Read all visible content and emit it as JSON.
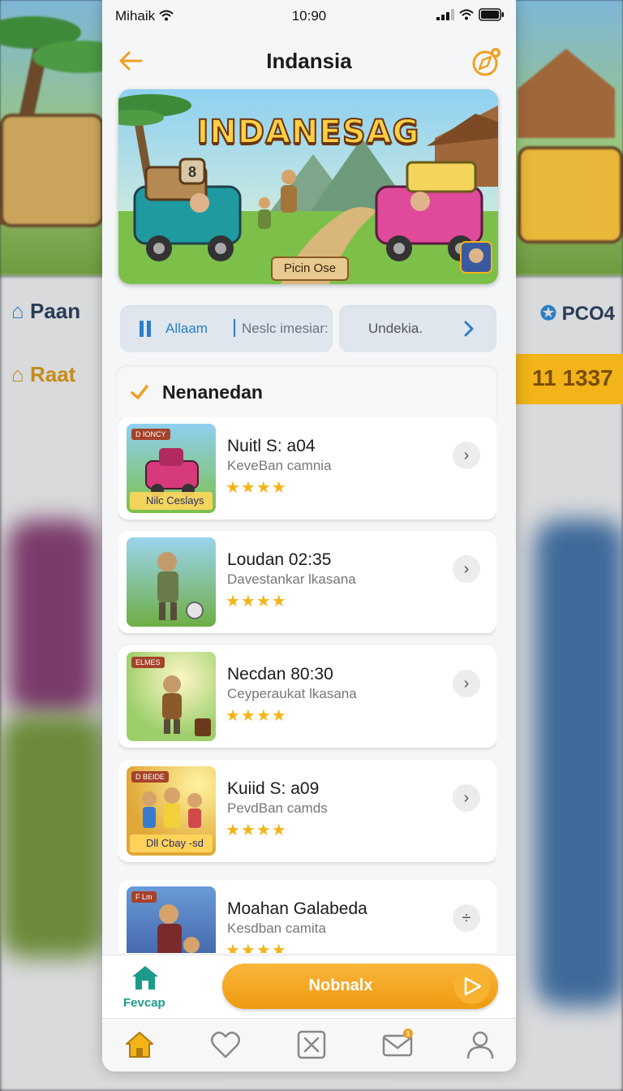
{
  "status_bar": {
    "carrier": "Mihaik",
    "time": "10:90"
  },
  "nav": {
    "title": "Indansia"
  },
  "banner": {
    "title": "INDANESAG",
    "badge": "Picin Ose"
  },
  "segments": {
    "left_label": "Allaam",
    "left_secondary": "Neslc imesiar:",
    "right_label": "Undekia."
  },
  "section": {
    "title": "Nenanedan"
  },
  "games": [
    {
      "title": "Nuitl S: a04",
      "subtitle": "KeveBan camnia",
      "stars": "★★★★",
      "tag": "D IONCY",
      "caption": "Nilc Ceslays",
      "scene": "truck"
    },
    {
      "title": "Loudan 02:35",
      "subtitle": "Davestankar lkasana",
      "stars": "★★★★",
      "tag": "",
      "caption": "",
      "scene": "warrior"
    },
    {
      "title": "Necdan 80:30",
      "subtitle": "Ceyperaukat lkasana",
      "stars": "★★★★",
      "tag": "ELMES",
      "caption": "",
      "scene": "hero"
    },
    {
      "title": "Kuiid S: a09",
      "subtitle": "PevdBan camds",
      "stars": "★★★★",
      "tag": "D BEIDE",
      "caption": "Dll Cbay -sd",
      "scene": "team"
    },
    {
      "title": "Moahan Galabeda",
      "subtitle": "Kesdban camita",
      "stars": "★★★★",
      "tag": "F Lm",
      "caption": "",
      "scene": "pirate"
    }
  ],
  "action_bar": {
    "home_label": "Fevcap",
    "cta_label": "Nobnalx"
  },
  "background": {
    "left_row1": "Paan",
    "left_row2": "Raat",
    "right_row1": "PCO4",
    "right_value": "11 1337"
  },
  "colors": {
    "accent": "#f0a020",
    "teal": "#1d9a8a",
    "blue": "#2a7fc6",
    "star": "#f2b418"
  },
  "tabs": [
    "home-icon",
    "heart-icon",
    "close-box-icon",
    "mail-icon",
    "profile-icon"
  ],
  "mail_badge": "1"
}
